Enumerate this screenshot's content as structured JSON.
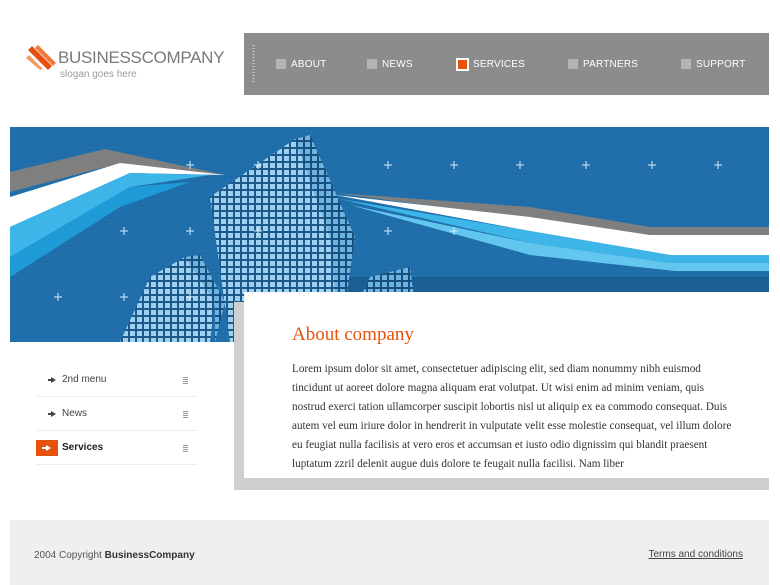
{
  "logo": {
    "name_part1": "BUSINESS",
    "name_part2": "COMPANY",
    "slogan": "slogan goes here"
  },
  "nav": {
    "items": [
      {
        "label": "ABOUT",
        "active": false
      },
      {
        "label": "NEWS",
        "active": false
      },
      {
        "label": "SERVICES",
        "active": true
      },
      {
        "label": "PARTNERS",
        "active": false
      },
      {
        "label": "SUPPORT",
        "active": false
      }
    ]
  },
  "sidebar": {
    "items": [
      {
        "label": "2nd menu",
        "active": false
      },
      {
        "label": "News",
        "active": false
      },
      {
        "label": "Services",
        "active": true
      }
    ]
  },
  "content": {
    "title": "About company",
    "body": "Lorem ipsum dolor sit amet, consectetuer adipiscing elit, sed diam nonummy nibh euismod tincidunt ut aoreet dolore magna aliquam erat volutpat. Ut wisi enim ad minim veniam, quis nostrud exerci tation ullamcorper suscipit lobortis nisl ut aliquip ex ea commodo consequat. Duis autem vel eum iriure dolor in hendrerit in vulputate velit esse molestie consequat, vel illum dolore eu feugiat nulla facilisis at vero eros et accumsan et iusto odio dignissim qui blandit praesent luptatum zzril delenit augue duis dolore te feugait nulla facilisi. Nam liber"
  },
  "footer": {
    "copyright_prefix": "2004 Copyright",
    "copyright_company": "BusinessCompany",
    "terms_label": "Terms and conditions"
  },
  "colors": {
    "accent": "#e8500f",
    "nav_bg": "#8c8c8c",
    "banner_blue": "#1f6ea9",
    "footer_bg": "#efefef"
  }
}
